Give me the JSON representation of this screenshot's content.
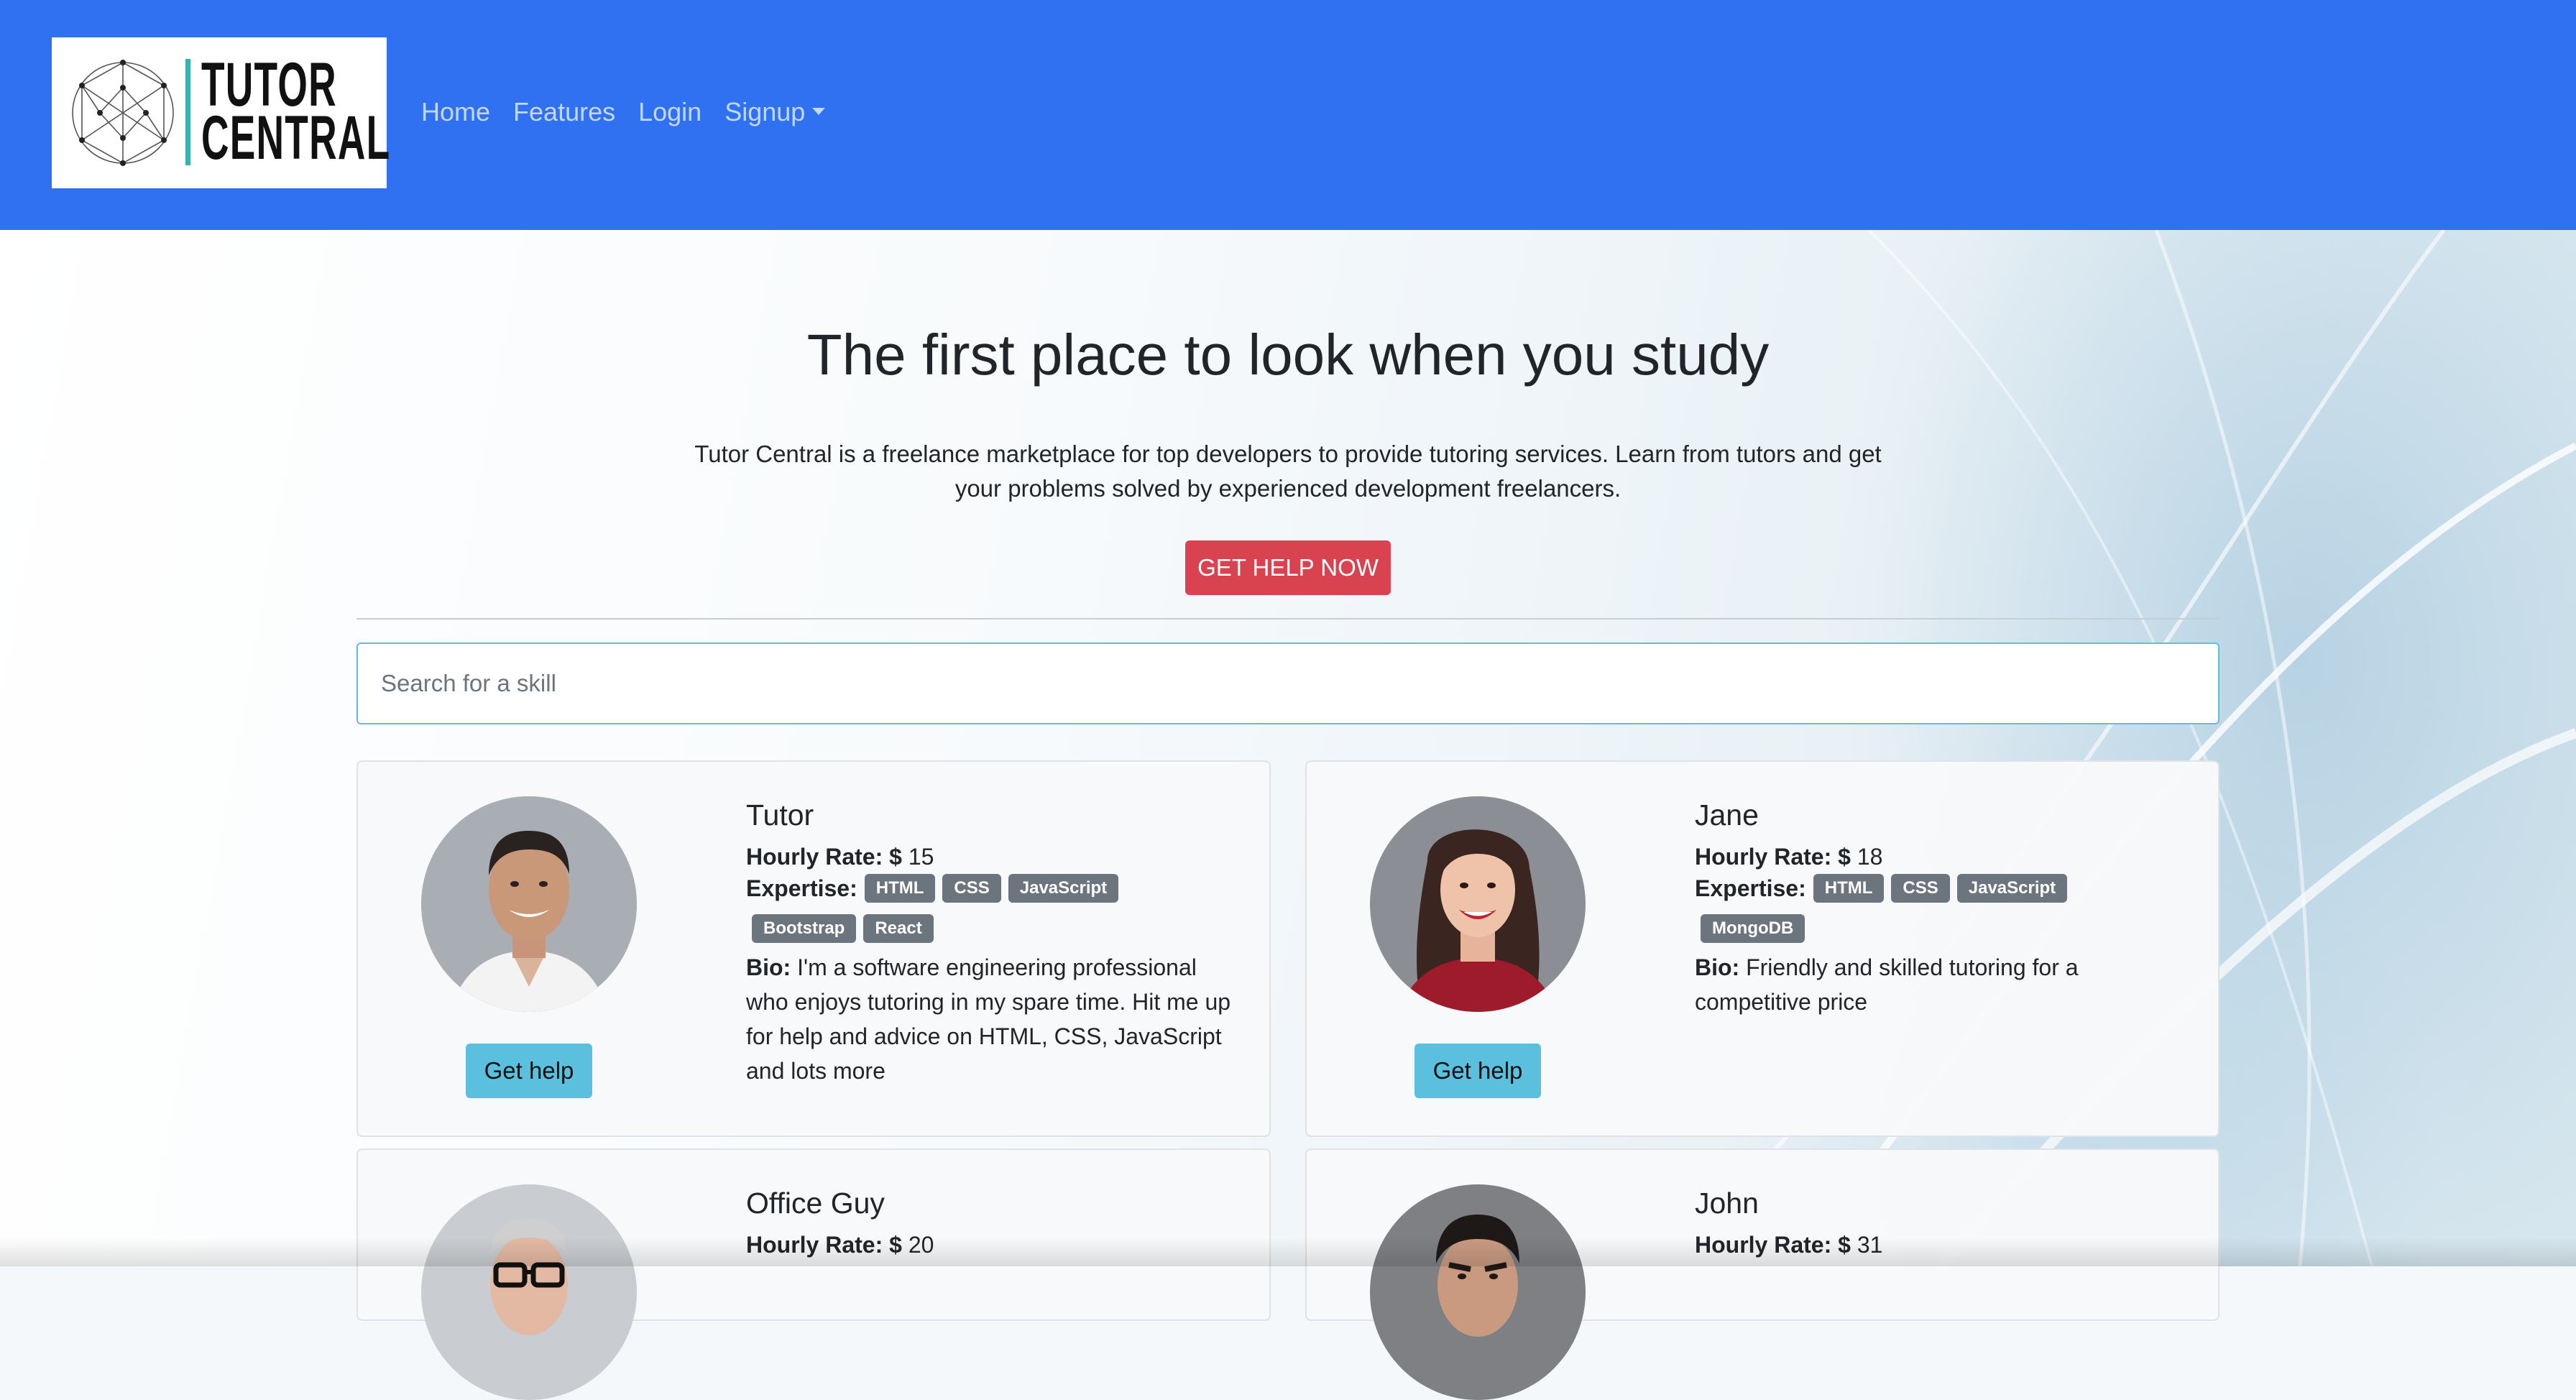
{
  "brand": {
    "logo_line1": "TUTOR",
    "logo_line2": "CENTRAL",
    "logo_icon": "geodesic-sphere-icon",
    "navbar_color": "#2f71f0"
  },
  "nav": {
    "items": [
      {
        "label": "Home"
      },
      {
        "label": "Features"
      },
      {
        "label": "Login"
      },
      {
        "label": "Signup"
      }
    ]
  },
  "hero": {
    "title": "The first place to look when you study",
    "text": "Tutor Central is a freelance marketplace for top developers to provide tutoring services. Learn from tutors and get your problems solved by experienced development freelancers.",
    "cta_label": "GET HELP NOW",
    "cta_color": "#d9424f"
  },
  "search": {
    "placeholder": "Search for a skill",
    "value": ""
  },
  "labels": {
    "hourly_rate": "Hourly Rate:",
    "expertise": "Expertise:",
    "bio": "Bio:",
    "currency": "$"
  },
  "tutors": [
    {
      "name": "Tutor",
      "rate": "15",
      "skills": [
        "HTML",
        "CSS",
        "JavaScript",
        "Bootstrap",
        "React"
      ],
      "bio": "I'm a software engineering professional who enjoys tutoring in my spare time. Hit me up for help and advice on HTML, CSS, JavaScript and lots more",
      "button": "Get help"
    },
    {
      "name": "Jane",
      "rate": "18",
      "skills": [
        "HTML",
        "CSS",
        "JavaScript",
        "MongoDB"
      ],
      "bio": "Friendly and skilled tutoring for a competitive price",
      "button": "Get help"
    },
    {
      "name": "Office Guy",
      "rate": "20",
      "skills": [],
      "bio": "",
      "button": ""
    },
    {
      "name": "John",
      "rate": "31",
      "skills": [],
      "bio": "",
      "button": ""
    }
  ],
  "colors": {
    "help_button": "#5bc0de",
    "badge": "#6c757d"
  }
}
